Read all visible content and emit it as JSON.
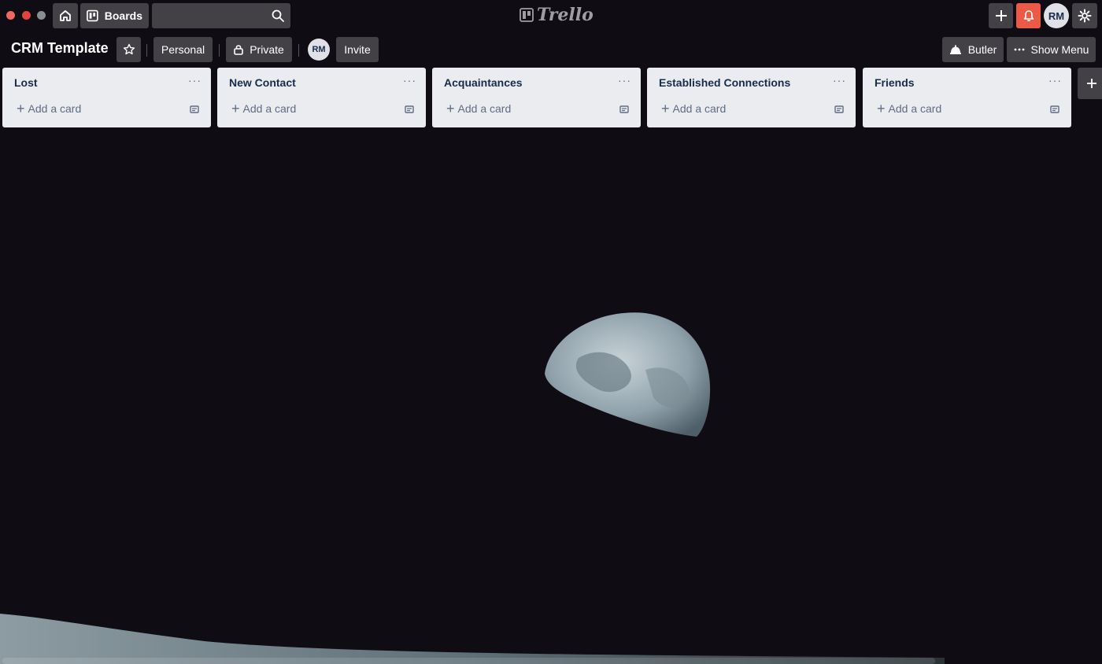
{
  "app": {
    "logo_text": "Trello"
  },
  "top_bar": {
    "boards_label": "Boards",
    "search_placeholder": "",
    "user_initials": "RM"
  },
  "board": {
    "title": "CRM Template",
    "visibility_team": "Personal",
    "visibility_privacy": "Private",
    "member_initials": "RM",
    "invite_label": "Invite",
    "butler_label": "Butler",
    "show_menu_label": "Show Menu"
  },
  "lists": [
    {
      "title": "Lost",
      "add_card": "Add a card"
    },
    {
      "title": "New Contact",
      "add_card": "Add a card"
    },
    {
      "title": "Acquaintances",
      "add_card": "Add a card"
    },
    {
      "title": "Established Connections",
      "add_card": "Add a card"
    },
    {
      "title": "Friends",
      "add_card": "Add a card"
    }
  ],
  "colors": {
    "notification": "#eb5a46",
    "list_bg": "#ebecf0",
    "board_bg": "#100c13"
  }
}
